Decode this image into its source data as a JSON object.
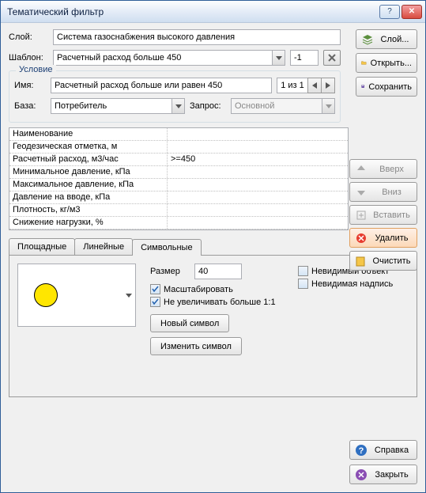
{
  "title": "Тематический фильтр",
  "labels": {
    "layer": "Слой:",
    "template": "Шаблон:",
    "condition": "Условие",
    "name": "Имя:",
    "base": "База:",
    "query": "Запрос:",
    "size": "Размер"
  },
  "values": {
    "layer": "Система газоснабжения высокого давления",
    "template": "Расчетный расход больше 450",
    "template_num": "-1",
    "name": "Расчетный расход больше или равен 450",
    "nav": "1 из 1",
    "base": "Потребитель",
    "query": "Основной",
    "size": "40"
  },
  "buttons": {
    "layer": "Слой...",
    "open": "Открыть...",
    "save": "Сохранить",
    "up": "Вверх",
    "down": "Вниз",
    "insert": "Вставить",
    "delete": "Удалить",
    "clear": "Очистить",
    "newsym": "Новый символ",
    "editsym": "Изменить символ",
    "help": "Справка",
    "close": "Закрыть"
  },
  "checks": {
    "scale": "Масштабировать",
    "noenlarge": "Не увеличивать больше 1:1",
    "invobj": "Невидимый объект",
    "invlabel": "Невидимая надпись"
  },
  "tabs": {
    "area": "Площадные",
    "line": "Линейные",
    "symbol": "Символьные"
  },
  "table": [
    {
      "k": "Наименование",
      "v": ""
    },
    {
      "k": "Геодезическая отметка, м",
      "v": ""
    },
    {
      "k": "Расчетный расход, м3/час",
      "v": ">=450"
    },
    {
      "k": "Минимальное давление, кПа",
      "v": ""
    },
    {
      "k": "Максимальное давление, кПа",
      "v": ""
    },
    {
      "k": "Давление на вводе, кПа",
      "v": ""
    },
    {
      "k": "Плотность, кг/м3",
      "v": ""
    },
    {
      "k": "Снижение нагрузки, %",
      "v": ""
    }
  ]
}
